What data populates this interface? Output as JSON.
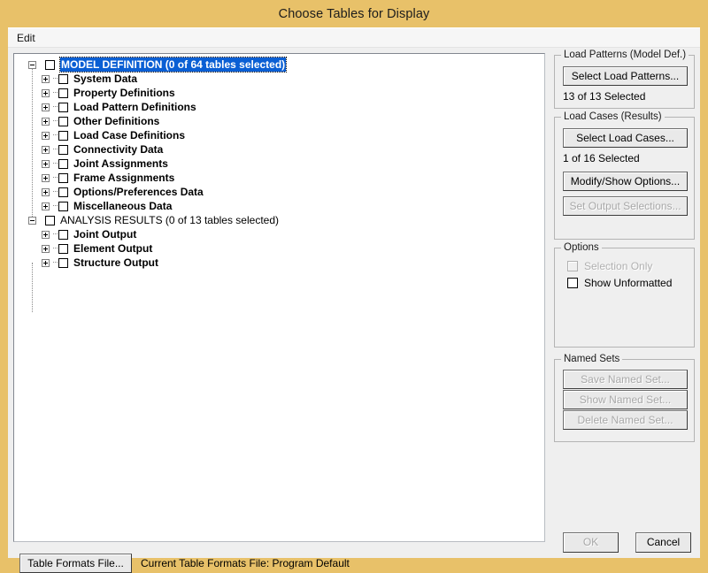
{
  "window": {
    "title": "Choose Tables for Display",
    "frame_color": "#e8c169",
    "background_color": "#efefef"
  },
  "menubar": {
    "items": [
      {
        "label": "Edit"
      }
    ]
  },
  "tree": {
    "nodes": [
      {
        "label": "MODEL DEFINITION  (0 of 64 tables selected)",
        "level": 0,
        "expander": "minus",
        "checked": false,
        "selected": true,
        "bold": true
      },
      {
        "label": "System Data",
        "level": 1,
        "expander": "plus",
        "checked": false,
        "selected": false,
        "bold": true
      },
      {
        "label": "Property Definitions",
        "level": 1,
        "expander": "plus",
        "checked": false,
        "selected": false,
        "bold": true
      },
      {
        "label": "Load Pattern Definitions",
        "level": 1,
        "expander": "plus",
        "checked": false,
        "selected": false,
        "bold": true
      },
      {
        "label": "Other Definitions",
        "level": 1,
        "expander": "plus",
        "checked": false,
        "selected": false,
        "bold": true
      },
      {
        "label": "Load Case Definitions",
        "level": 1,
        "expander": "plus",
        "checked": false,
        "selected": false,
        "bold": true
      },
      {
        "label": "Connectivity Data",
        "level": 1,
        "expander": "plus",
        "checked": false,
        "selected": false,
        "bold": true
      },
      {
        "label": "Joint Assignments",
        "level": 1,
        "expander": "plus",
        "checked": false,
        "selected": false,
        "bold": true
      },
      {
        "label": "Frame Assignments",
        "level": 1,
        "expander": "plus",
        "checked": false,
        "selected": false,
        "bold": true
      },
      {
        "label": "Options/Preferences Data",
        "level": 1,
        "expander": "plus",
        "checked": false,
        "selected": false,
        "bold": true
      },
      {
        "label": "Miscellaneous Data",
        "level": 1,
        "expander": "plus",
        "checked": false,
        "selected": false,
        "bold": true
      },
      {
        "label": "ANALYSIS RESULTS  (0 of 13 tables selected)",
        "level": 0,
        "expander": "minus",
        "checked": false,
        "selected": false,
        "bold": false
      },
      {
        "label": "Joint Output",
        "level": 1,
        "expander": "plus",
        "checked": false,
        "selected": false,
        "bold": true
      },
      {
        "label": "Element Output",
        "level": 1,
        "expander": "plus",
        "checked": false,
        "selected": false,
        "bold": true
      },
      {
        "label": "Structure Output",
        "level": 1,
        "expander": "plus",
        "checked": false,
        "selected": false,
        "bold": true
      }
    ],
    "selection_color": "#0a5fd4"
  },
  "load_patterns": {
    "group_title": "Load Patterns (Model Def.)",
    "select_button": "Select Load Patterns...",
    "status": "13 of 13 Selected"
  },
  "load_cases": {
    "group_title": "Load Cases (Results)",
    "select_button": "Select Load Cases...",
    "status": "1 of 16 Selected",
    "modify_button": "Modify/Show Options...",
    "output_button": "Set Output Selections..."
  },
  "options": {
    "group_title": "Options",
    "selection_only_label": "Selection Only",
    "selection_only_checked": false,
    "show_unformatted_label": "Show Unformatted",
    "show_unformatted_checked": false
  },
  "named_sets": {
    "group_title": "Named Sets",
    "save_button": "Save Named Set...",
    "show_button": "Show Named Set...",
    "delete_button": "Delete Named Set..."
  },
  "footer": {
    "ok_button": "OK",
    "cancel_button": "Cancel",
    "table_formats_button": "Table Formats File...",
    "current_format_status": "Current Table Formats File:  Program Default"
  }
}
